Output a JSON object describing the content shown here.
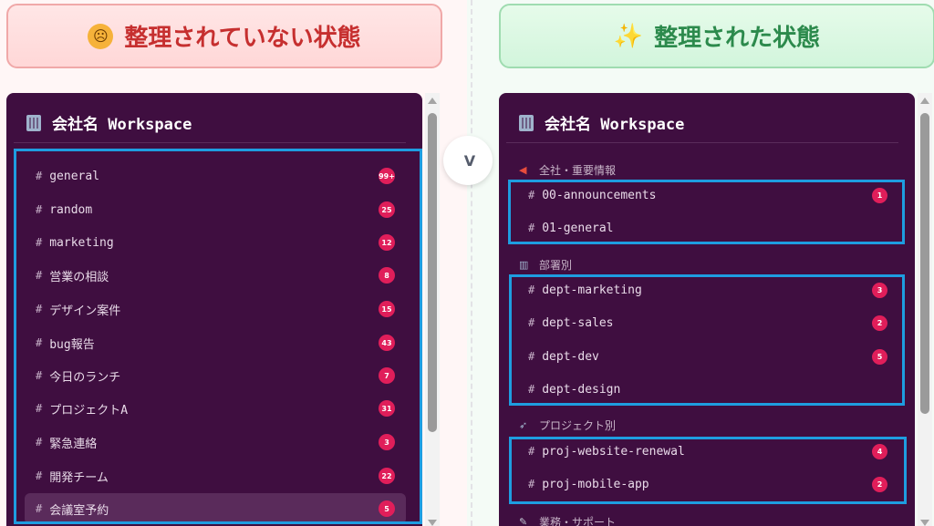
{
  "left": {
    "header": "整理されていない状態",
    "workspace": "会社名 Workspace",
    "channels": [
      {
        "name": "general",
        "badge": "99+"
      },
      {
        "name": "random",
        "badge": "25"
      },
      {
        "name": "marketing",
        "badge": "12"
      },
      {
        "name": "営業の相談",
        "badge": "8"
      },
      {
        "name": "デザイン案件",
        "badge": "15"
      },
      {
        "name": "bug報告",
        "badge": "43"
      },
      {
        "name": "今日のランチ",
        "badge": "7"
      },
      {
        "name": "プロジェクトA",
        "badge": "31"
      },
      {
        "name": "緊急連絡",
        "badge": "3"
      },
      {
        "name": "開発チーム",
        "badge": "22"
      },
      {
        "name": "会議室予約",
        "badge": "5"
      }
    ]
  },
  "right": {
    "header": "整理された状態",
    "workspace": "会社名 Workspace",
    "sections": [
      {
        "title": "全社・重要情報",
        "icon": "megaphone-icon",
        "channels": [
          {
            "name": "00-announcements",
            "badge": "1"
          },
          {
            "name": "01-general",
            "badge": ""
          }
        ]
      },
      {
        "title": "部署別",
        "icon": "building-icon",
        "channels": [
          {
            "name": "dept-marketing",
            "badge": "3"
          },
          {
            "name": "dept-sales",
            "badge": "2"
          },
          {
            "name": "dept-dev",
            "badge": "5"
          },
          {
            "name": "dept-design",
            "badge": ""
          }
        ]
      },
      {
        "title": "プロジェクト別",
        "icon": "rocket-icon",
        "channels": [
          {
            "name": "proj-website-renewal",
            "badge": "4"
          },
          {
            "name": "proj-mobile-app",
            "badge": "2"
          }
        ]
      },
      {
        "title": "業務・サポート",
        "icon": "wrench-icon",
        "channels": []
      }
    ]
  },
  "vs_label": "V",
  "hash_symbol": "#",
  "colors": {
    "sidebar_bg": "#3f0e40",
    "badge": "#e01e5a",
    "highlight_box": "#1e9de0",
    "left_header_text": "#c62f2f",
    "right_header_text": "#2c8a4c"
  }
}
